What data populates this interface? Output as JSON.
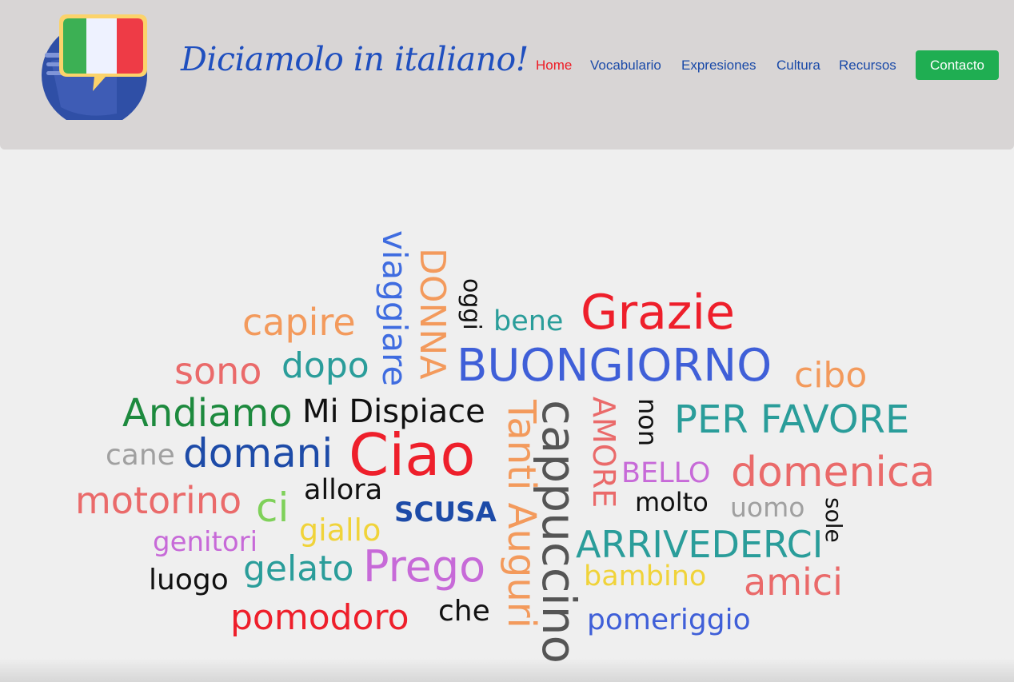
{
  "header": {
    "logo_icon": "italian-flag-speech-bubble-icon",
    "site_title": "Diciamolo in italiano!",
    "nav": {
      "home": "Home",
      "vocabulario": "Vocabulario",
      "expresiones": "Expresiones",
      "cultura": "Cultura",
      "recursos": "Recursos",
      "contacto": "Contacto"
    },
    "colors": {
      "active": "#ee1b24",
      "link": "#1a4aa8",
      "contact_button": "#1fae52",
      "header_bg": "#d8d5d5"
    }
  },
  "word_cloud": {
    "viaggiare": "viaggiare",
    "donna": "DONNA",
    "oggi": "oggi",
    "bene": "bene",
    "grazie": "Grazie",
    "capire": "capire",
    "sono": "sono",
    "dopo": "dopo",
    "buongiorno": "BUONGIORNO",
    "cibo": "cibo",
    "andiamo": "Andiamo",
    "mi_dispiace": "Mi Dispiace",
    "tanti_auguri": "Tanti Auguri",
    "cappuccino": "cappuccino",
    "amore": "AMORE",
    "non": "non",
    "per_favore": "PER FAVORE",
    "cane": "cane",
    "domani": "domani",
    "ciao": "Ciao",
    "bello": "BELLO",
    "domenica": "domenica",
    "motorino": "motorino",
    "ci": "ci",
    "allora": "allora",
    "scusa": "SCUSA",
    "molto": "molto",
    "uomo": "uomo",
    "sole": "sole",
    "genitori": "genitori",
    "giallo": "giallo",
    "arrivederci": "ARRIVEDERCI",
    "luogo": "luogo",
    "gelato": "gelato",
    "prego": "Prego",
    "bambino": "bambino",
    "amici": "amici",
    "pomodoro": "pomodoro",
    "che": "che",
    "pomeriggio": "pomeriggio"
  }
}
